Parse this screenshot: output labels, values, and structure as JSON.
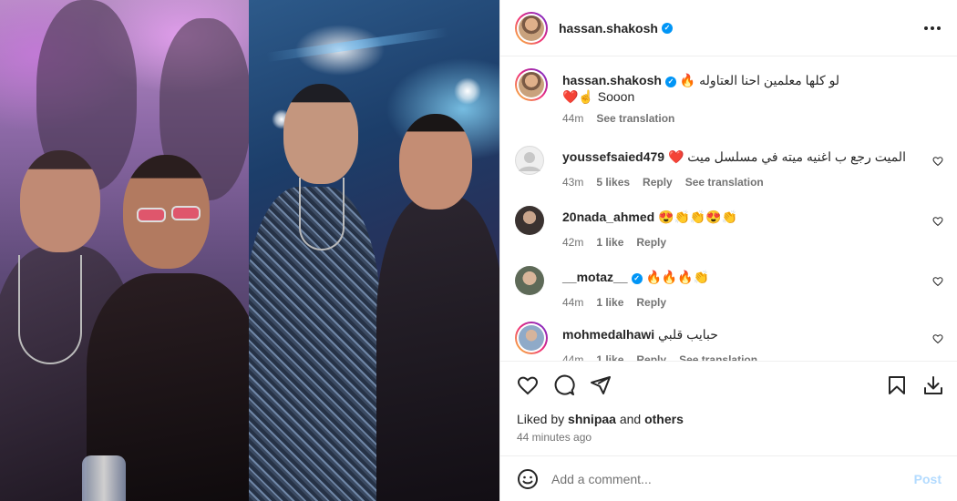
{
  "post": {
    "author": "hassan.shakosh",
    "verified": true
  },
  "caption": {
    "username": "hassan.shakosh",
    "arabic": "لو كلها معلمين احنا العتاوله",
    "line1_emoji": "🔥",
    "line2_emoji": "❤️☝️",
    "line2_text": "Sooon",
    "time": "44m",
    "see_translation": "See translation"
  },
  "comments": [
    {
      "username": "youssefsaied479",
      "emoji": "❤️",
      "text": "الميت رجع ب اغنيه ميته في مسلسل ميت",
      "time": "43m",
      "likes": "5 likes",
      "reply": "Reply",
      "see_translation": "See translation"
    },
    {
      "username": "20nada_ahmed",
      "text": "😍👏👏😍👏",
      "time": "42m",
      "likes": "1 like",
      "reply": "Reply"
    },
    {
      "username": "__motaz__",
      "verified": true,
      "text": "🔥🔥🔥👏",
      "time": "44m",
      "likes": "1 like",
      "reply": "Reply"
    },
    {
      "username": "mohmedalhawi",
      "text": "حبايب قلبي",
      "time": "44m",
      "likes": "1 like",
      "reply": "Reply",
      "see_translation": "See translation"
    }
  ],
  "actions": {
    "liked_by_prefix": "Liked by",
    "liked_by_user": "shnipaa",
    "liked_by_and": "and",
    "liked_by_others": "others",
    "time_ago": "44 minutes ago"
  },
  "add_comment": {
    "placeholder": "Add a comment...",
    "post_label": "Post"
  },
  "icons": {
    "like": "heart-icon",
    "comment": "comment-icon",
    "share": "share-icon",
    "save": "bookmark-icon",
    "download": "download-icon",
    "emoji": "smiley-icon",
    "more": "more-options-icon"
  },
  "colors": {
    "accent": "#0095f6",
    "post_disabled": "#b3dbff",
    "muted_text": "#737373",
    "divider": "#efefef"
  }
}
